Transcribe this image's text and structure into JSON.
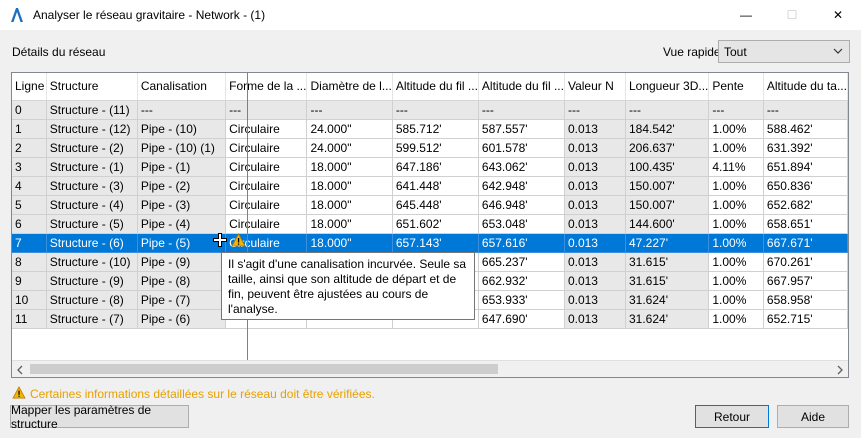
{
  "window": {
    "title": "Analyser le réseau gravitaire - Network - (1)",
    "minimize": "—",
    "maximize": "☐",
    "close": "✕"
  },
  "section_label": "Détails du réseau",
  "quick_view": {
    "label": "Vue rapide",
    "value": "Tout"
  },
  "columns": [
    "Ligne",
    "Structure",
    "Canalisation",
    "Forme de la ...",
    "Diamètre de l...",
    "Altitude du fil ...",
    "Altitude du fil ...",
    "Valeur N",
    "Longueur 3D...",
    "Pente",
    "Altitude du ta..."
  ],
  "rows": [
    [
      "0",
      "Structure - (11)",
      "---",
      "---",
      "---",
      "---",
      "---",
      "---",
      "---",
      "---",
      "---"
    ],
    [
      "1",
      "Structure - (12)",
      "Pipe - (10)",
      "Circulaire",
      "24.000\"",
      "585.712'",
      "587.557'",
      "0.013",
      "184.542'",
      "1.00%",
      "588.462'"
    ],
    [
      "2",
      "Structure - (2)",
      "Pipe - (10) (1)",
      "Circulaire",
      "24.000\"",
      "599.512'",
      "601.578'",
      "0.013",
      "206.637'",
      "1.00%",
      "631.392'"
    ],
    [
      "3",
      "Structure - (1)",
      "Pipe - (1)",
      "Circulaire",
      "18.000\"",
      "647.186'",
      "643.062'",
      "0.013",
      "100.435'",
      "4.11%",
      "651.894'"
    ],
    [
      "4",
      "Structure - (3)",
      "Pipe - (2)",
      "Circulaire",
      "18.000\"",
      "641.448'",
      "642.948'",
      "0.013",
      "150.007'",
      "1.00%",
      "650.836'"
    ],
    [
      "5",
      "Structure - (4)",
      "Pipe - (3)",
      "Circulaire",
      "18.000\"",
      "645.448'",
      "646.948'",
      "0.013",
      "150.007'",
      "1.00%",
      "652.682'"
    ],
    [
      "6",
      "Structure - (5)",
      "Pipe - (4)",
      "Circulaire",
      "18.000\"",
      "651.602'",
      "653.048'",
      "0.013",
      "144.600'",
      "1.00%",
      "658.651'"
    ],
    [
      "7",
      "Structure - (6)",
      "Pipe - (5)",
      "Circulaire",
      "18.000\"",
      "657.143'",
      "657.616'",
      "0.013",
      "47.227'",
      "1.00%",
      "667.671'"
    ],
    [
      "8",
      "Structure - (10)",
      "Pipe - (9)",
      "",
      "",
      "",
      "665.237'",
      "0.013",
      "31.615'",
      "1.00%",
      "670.261'"
    ],
    [
      "9",
      "Structure - (9)",
      "Pipe - (8)",
      "",
      "",
      "",
      "662.932'",
      "0.013",
      "31.615'",
      "1.00%",
      "667.957'"
    ],
    [
      "10",
      "Structure - (8)",
      "Pipe - (7)",
      "",
      "",
      "",
      "653.933'",
      "0.013",
      "31.624'",
      "1.00%",
      "658.958'"
    ],
    [
      "11",
      "Structure - (7)",
      "Pipe - (6)",
      "",
      "",
      "",
      "647.690'",
      "0.013",
      "31.624'",
      "1.00%",
      "652.715'"
    ]
  ],
  "selected_row": 7,
  "tooltip": "Il s'agit d'une canalisation incurvée. Seule sa taille, ainsi que son altitude de départ et de fin, peuvent être ajustées au cours de l'analyse.",
  "warning": "Certaines informations détaillées sur le réseau doit être vérifiées.",
  "buttons": {
    "map_structures": "Mapper les paramètres de structure",
    "back": "Retour",
    "help": "Aide"
  },
  "colors": {
    "selection": "#0078d7",
    "warning": "#e8a000",
    "gray_cell": "#e8e8e8"
  }
}
